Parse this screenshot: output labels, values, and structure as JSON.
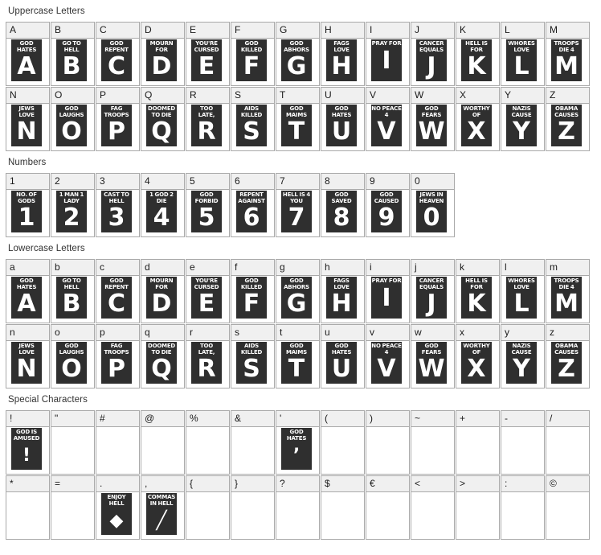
{
  "sections": [
    {
      "title": "Uppercase Letters",
      "name": "uppercase-letters",
      "cells": [
        {
          "key": "A",
          "caption": "GOD HATES",
          "glyph": "A"
        },
        {
          "key": "B",
          "caption": "GO TO HELL",
          "glyph": "B"
        },
        {
          "key": "C",
          "caption": "GOD REPENT",
          "glyph": "C"
        },
        {
          "key": "D",
          "caption": "MOURN FOR",
          "glyph": "D"
        },
        {
          "key": "E",
          "caption": "YOU'RE CURSED",
          "glyph": "E"
        },
        {
          "key": "F",
          "caption": "GOD KILLED",
          "glyph": "F"
        },
        {
          "key": "G",
          "caption": "GOD ABHORS",
          "glyph": "G"
        },
        {
          "key": "H",
          "caption": "FAGS LOVE",
          "glyph": "H"
        },
        {
          "key": "I",
          "caption": "PRAY FOR",
          "glyph": "I"
        },
        {
          "key": "J",
          "caption": "CANCER EQUALS",
          "glyph": "J"
        },
        {
          "key": "K",
          "caption": "HELL IS FOR",
          "glyph": "K"
        },
        {
          "key": "L",
          "caption": "WHORES LOVE",
          "glyph": "L"
        },
        {
          "key": "M",
          "caption": "TROOPS DIE 4",
          "glyph": "M"
        },
        {
          "key": "N",
          "caption": "JEWS LOVE",
          "glyph": "N"
        },
        {
          "key": "O",
          "caption": "GOD LAUGHS",
          "glyph": "O"
        },
        {
          "key": "P",
          "caption": "FAG TROOPS",
          "glyph": "P"
        },
        {
          "key": "Q",
          "caption": "DOOMED TO DIE",
          "glyph": "Q"
        },
        {
          "key": "R",
          "caption": "TOO LATE,",
          "glyph": "R"
        },
        {
          "key": "S",
          "caption": "AIDS KILLED",
          "glyph": "S"
        },
        {
          "key": "T",
          "caption": "GOD MAIMS",
          "glyph": "T"
        },
        {
          "key": "U",
          "caption": "GOD HATES",
          "glyph": "U"
        },
        {
          "key": "V",
          "caption": "NO PEACE 4",
          "glyph": "V"
        },
        {
          "key": "W",
          "caption": "GOD FEARS",
          "glyph": "W"
        },
        {
          "key": "X",
          "caption": "WORTHY OF",
          "glyph": "X"
        },
        {
          "key": "Y",
          "caption": "NAZIS CAUSE",
          "glyph": "Y"
        },
        {
          "key": "Z",
          "caption": "OBAMA CAUSES",
          "glyph": "Z"
        }
      ]
    },
    {
      "title": "Numbers",
      "name": "numbers",
      "cells": [
        {
          "key": "1",
          "caption": "NO. OF GODS",
          "glyph": "1"
        },
        {
          "key": "2",
          "caption": "1 MAN 1 LADY",
          "glyph": "2"
        },
        {
          "key": "3",
          "caption": "CAST TO HELL",
          "glyph": "3"
        },
        {
          "key": "4",
          "caption": "1 GOD 2 DIE",
          "glyph": "4"
        },
        {
          "key": "5",
          "caption": "GOD FORBID",
          "glyph": "5"
        },
        {
          "key": "6",
          "caption": "REPENT AGAINST",
          "glyph": "6"
        },
        {
          "key": "7",
          "caption": "HELL IS 4 YOU",
          "glyph": "7"
        },
        {
          "key": "8",
          "caption": "GOD SAVED",
          "glyph": "8"
        },
        {
          "key": "9",
          "caption": "GOD CAUSED",
          "glyph": "9"
        },
        {
          "key": "0",
          "caption": "JEWS IN HEAVEN",
          "glyph": "0"
        }
      ]
    },
    {
      "title": "Lowercase Letters",
      "name": "lowercase-letters",
      "cells": [
        {
          "key": "a",
          "caption": "GOD HATES",
          "glyph": "A"
        },
        {
          "key": "b",
          "caption": "GO TO HELL",
          "glyph": "B"
        },
        {
          "key": "c",
          "caption": "GOD REPENT",
          "glyph": "C"
        },
        {
          "key": "d",
          "caption": "MOURN FOR",
          "glyph": "D"
        },
        {
          "key": "e",
          "caption": "YOU'RE CURSED",
          "glyph": "E"
        },
        {
          "key": "f",
          "caption": "GOD KILLED",
          "glyph": "F"
        },
        {
          "key": "g",
          "caption": "GOD ABHORS",
          "glyph": "G"
        },
        {
          "key": "h",
          "caption": "FAGS LOVE",
          "glyph": "H"
        },
        {
          "key": "i",
          "caption": "PRAY FOR",
          "glyph": "I"
        },
        {
          "key": "j",
          "caption": "CANCER EQUALS",
          "glyph": "J"
        },
        {
          "key": "k",
          "caption": "HELL IS FOR",
          "glyph": "K"
        },
        {
          "key": "l",
          "caption": "WHORES LOVE",
          "glyph": "L"
        },
        {
          "key": "m",
          "caption": "TROOPS DIE 4",
          "glyph": "M"
        },
        {
          "key": "n",
          "caption": "JEWS LOVE",
          "glyph": "N"
        },
        {
          "key": "o",
          "caption": "GOD LAUGHS",
          "glyph": "O"
        },
        {
          "key": "p",
          "caption": "FAG TROOPS",
          "glyph": "P"
        },
        {
          "key": "q",
          "caption": "DOOMED TO DIE",
          "glyph": "Q"
        },
        {
          "key": "r",
          "caption": "TOO LATE,",
          "glyph": "R"
        },
        {
          "key": "s",
          "caption": "AIDS KILLED",
          "glyph": "S"
        },
        {
          "key": "t",
          "caption": "GOD MAIMS",
          "glyph": "T"
        },
        {
          "key": "u",
          "caption": "GOD HATES",
          "glyph": "U"
        },
        {
          "key": "v",
          "caption": "NO PEACE 4",
          "glyph": "V"
        },
        {
          "key": "w",
          "caption": "GOD FEARS",
          "glyph": "W"
        },
        {
          "key": "x",
          "caption": "WORTHY OF",
          "glyph": "X"
        },
        {
          "key": "y",
          "caption": "NAZIS CAUSE",
          "glyph": "Y"
        },
        {
          "key": "z",
          "caption": "OBAMA CAUSES",
          "glyph": "Z"
        }
      ]
    },
    {
      "title": "Special Characters",
      "name": "special-characters",
      "cells": [
        {
          "key": "!",
          "caption": "GOD IS AMUSED",
          "glyph": "!"
        },
        {
          "key": "\"",
          "caption": "",
          "glyph": ""
        },
        {
          "key": "#",
          "caption": "",
          "glyph": ""
        },
        {
          "key": "@",
          "caption": "",
          "glyph": ""
        },
        {
          "key": "%",
          "caption": "",
          "glyph": ""
        },
        {
          "key": "&",
          "caption": "",
          "glyph": ""
        },
        {
          "key": "'",
          "caption": "GOD HATES",
          "glyph": "’"
        },
        {
          "key": "(",
          "caption": "",
          "glyph": ""
        },
        {
          "key": ")",
          "caption": "",
          "glyph": ""
        },
        {
          "key": "~",
          "caption": "",
          "glyph": ""
        },
        {
          "key": "+",
          "caption": "",
          "glyph": ""
        },
        {
          "key": "-",
          "caption": "",
          "glyph": ""
        },
        {
          "key": "/",
          "caption": "",
          "glyph": ""
        },
        {
          "key": "*",
          "caption": "",
          "glyph": ""
        },
        {
          "key": "=",
          "caption": "",
          "glyph": ""
        },
        {
          "key": ".",
          "caption": "ENJOY HELL",
          "glyph": "◆"
        },
        {
          "key": ",",
          "caption": "COMMAS IN HELL",
          "glyph": "╱"
        },
        {
          "key": "{",
          "caption": "",
          "glyph": ""
        },
        {
          "key": "}",
          "caption": "",
          "glyph": ""
        },
        {
          "key": "?",
          "caption": "",
          "glyph": ""
        },
        {
          "key": "$",
          "caption": "",
          "glyph": ""
        },
        {
          "key": "€",
          "caption": "",
          "glyph": ""
        },
        {
          "key": "<",
          "caption": "",
          "glyph": ""
        },
        {
          "key": ">",
          "caption": "",
          "glyph": ""
        },
        {
          "key": ":",
          "caption": "",
          "glyph": ""
        },
        {
          "key": "©",
          "caption": "",
          "glyph": ""
        }
      ]
    }
  ],
  "colors": {
    "poster_bg": "#2f2f2f",
    "poster_fg": "#ffffff",
    "cell_header_bg": "#f0f0f0",
    "cell_border": "#a9a9a9",
    "page_bg": "#ffffff",
    "title_text": "#333333"
  }
}
